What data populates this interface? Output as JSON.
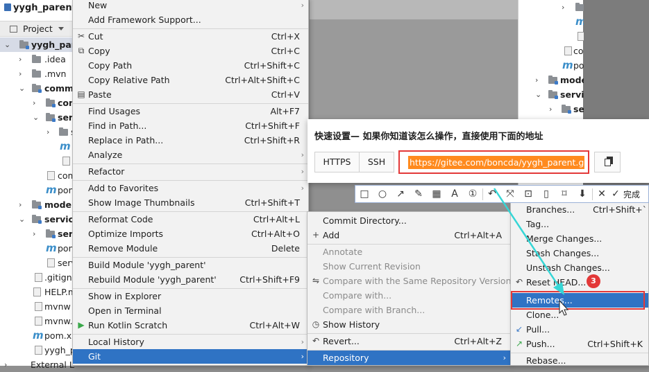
{
  "project_tree": {
    "title": "yygh_parent",
    "tab_label": "Project",
    "rows": [
      {
        "text": "yygh_pare"
      },
      {
        "text": ".idea"
      },
      {
        "text": ".mvn"
      },
      {
        "text": "commo"
      },
      {
        "text": "com"
      },
      {
        "text": "serv"
      },
      {
        "text": "s"
      },
      {
        "text": ""
      },
      {
        "text": ""
      },
      {
        "text": "com"
      },
      {
        "text": "pom"
      },
      {
        "text": "model"
      },
      {
        "text": "service"
      },
      {
        "text": "serv"
      },
      {
        "text": "pon"
      },
      {
        "text": "serv"
      },
      {
        "text": ".gitignc"
      },
      {
        "text": "HELP.m"
      },
      {
        "text": "mvnw"
      },
      {
        "text": "mvnw.c"
      },
      {
        "text": "pom.xn"
      },
      {
        "text": "yygh_pa"
      },
      {
        "text": "External Lil"
      }
    ]
  },
  "context_menu": {
    "items": [
      {
        "label": "New",
        "shortcut": "",
        "submenu": true
      },
      {
        "label": "Add Framework Support...",
        "shortcut": ""
      },
      {
        "label": "Cut",
        "shortcut": "Ctrl+X",
        "icon": "scissors-icon"
      },
      {
        "label": "Copy",
        "shortcut": "Ctrl+C",
        "icon": "copy-icon"
      },
      {
        "label": "Copy Path",
        "shortcut": "Ctrl+Shift+C"
      },
      {
        "label": "Copy Relative Path",
        "shortcut": "Ctrl+Alt+Shift+C"
      },
      {
        "label": "Paste",
        "shortcut": "Ctrl+V",
        "icon": "paste-icon"
      },
      {
        "label": "Find Usages",
        "shortcut": "Alt+F7"
      },
      {
        "label": "Find in Path...",
        "shortcut": "Ctrl+Shift+F"
      },
      {
        "label": "Replace in Path...",
        "shortcut": "Ctrl+Shift+R"
      },
      {
        "label": "Analyze",
        "shortcut": "",
        "submenu": true
      },
      {
        "label": "Refactor",
        "shortcut": "",
        "submenu": true
      },
      {
        "label": "Add to Favorites",
        "shortcut": "",
        "submenu": true
      },
      {
        "label": "Show Image Thumbnails",
        "shortcut": "Ctrl+Shift+T"
      },
      {
        "label": "Reformat Code",
        "shortcut": "Ctrl+Alt+L"
      },
      {
        "label": "Optimize Imports",
        "shortcut": "Ctrl+Alt+O"
      },
      {
        "label": "Remove Module",
        "shortcut": "Delete"
      },
      {
        "label": "Build Module 'yygh_parent'",
        "shortcut": ""
      },
      {
        "label": "Rebuild Module 'yygh_parent'",
        "shortcut": "Ctrl+Shift+F9"
      },
      {
        "label": "Show in Explorer",
        "shortcut": ""
      },
      {
        "label": "Open in Terminal",
        "shortcut": ""
      },
      {
        "label": "Run Kotlin Scratch",
        "shortcut": "Ctrl+Alt+W",
        "icon": "run-icon"
      },
      {
        "label": "Local History",
        "shortcut": "",
        "submenu": true
      },
      {
        "label": "Git",
        "shortcut": "",
        "submenu": true
      }
    ]
  },
  "git_menu": {
    "items": [
      {
        "label": "Commit Directory...",
        "shortcut": ""
      },
      {
        "label": "Add",
        "shortcut": "Ctrl+Alt+A",
        "icon": "plus-icon"
      },
      {
        "label": "Annotate",
        "shortcut": ""
      },
      {
        "label": "Show Current Revision",
        "shortcut": ""
      },
      {
        "label": "Compare with the Same Repository Version",
        "shortcut": ""
      },
      {
        "label": "Compare with...",
        "shortcut": ""
      },
      {
        "label": "Compare with Branch...",
        "shortcut": ""
      },
      {
        "label": "Show History",
        "shortcut": "",
        "icon": "clock-icon"
      },
      {
        "label": "Revert...",
        "shortcut": "Ctrl+Alt+Z",
        "icon": "revert-icon"
      },
      {
        "label": "Repository",
        "shortcut": "",
        "submenu": true
      }
    ]
  },
  "repository_menu": {
    "items": [
      {
        "label": "Branches...",
        "shortcut": "Ctrl+Shift+`"
      },
      {
        "label": "Tag...",
        "shortcut": ""
      },
      {
        "label": "Merge Changes...",
        "shortcut": ""
      },
      {
        "label": "Stash Changes...",
        "shortcut": ""
      },
      {
        "label": "Unstash Changes...",
        "shortcut": ""
      },
      {
        "label": "Reset HEAD...",
        "shortcut": "",
        "icon": "reset-icon"
      },
      {
        "label": "Remotes...",
        "shortcut": ""
      },
      {
        "label": "Clone...",
        "shortcut": ""
      },
      {
        "label": "Pull...",
        "shortcut": "",
        "icon": "pull-icon"
      },
      {
        "label": "Push...",
        "shortcut": "Ctrl+Shift+K",
        "icon": "push-icon"
      },
      {
        "label": "Rebase...",
        "shortcut": ""
      }
    ]
  },
  "right_panel": {
    "rows": [
      {
        "text": ""
      },
      {
        "text": ""
      },
      {
        "text": "co"
      },
      {
        "text": "po"
      },
      {
        "text": "mode"
      },
      {
        "text": "servic"
      },
      {
        "text": "se"
      }
    ]
  },
  "gitee_popup": {
    "title": "快速设置— 如果你知道该怎么操作，直接使用下面的地址",
    "https_label": "HTTPS",
    "ssh_label": "SSH",
    "url": "https://gitee.com/boncda/yygh_parent.git"
  },
  "screenshot_toolbar": {
    "done_label": "完成"
  },
  "annotation": {
    "step_number": "3"
  },
  "colors": {
    "highlight": "#2f73c4",
    "annotation_red": "#e33838",
    "url_selection": "#ff8a1e"
  }
}
